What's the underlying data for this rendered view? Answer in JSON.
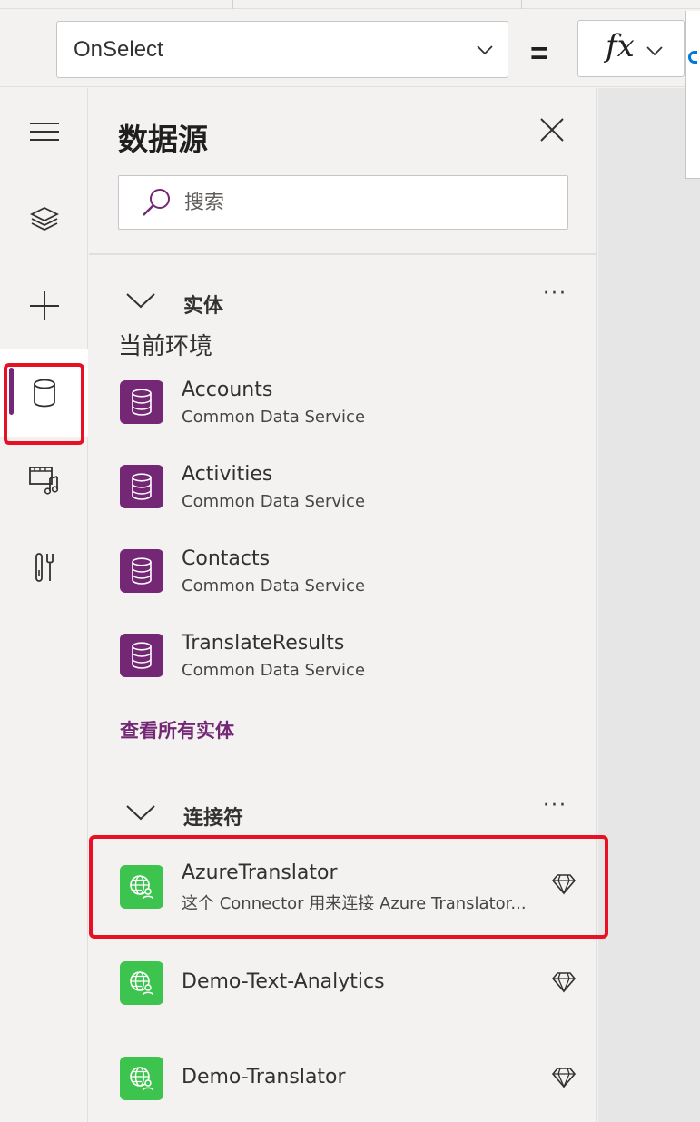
{
  "formula_bar": {
    "property": "OnSelect",
    "equals": "=",
    "fx_label": "fx"
  },
  "rail": {
    "items": [
      {
        "name": "hamburger-menu-icon"
      },
      {
        "name": "layers-icon"
      },
      {
        "name": "insert-plus-icon"
      },
      {
        "name": "database-icon",
        "active": true
      },
      {
        "name": "media-icon"
      },
      {
        "name": "tools-icon"
      }
    ]
  },
  "panel": {
    "title": "数据源",
    "search_placeholder": "搜索",
    "entities": {
      "heading": "实体",
      "more": "···",
      "environment": "当前环境",
      "items": [
        {
          "name": "Accounts",
          "source": "Common Data Service"
        },
        {
          "name": "Activities",
          "source": "Common Data Service"
        },
        {
          "name": "Contacts",
          "source": "Common Data Service"
        },
        {
          "name": "TranslateResults",
          "source": "Common Data Service"
        }
      ],
      "see_all": "查看所有实体"
    },
    "connectors": {
      "heading": "连接符",
      "more": "···",
      "items": [
        {
          "name": "AzureTranslator",
          "description": "这个 Connector 用来连接 Azure Translator..."
        },
        {
          "name": "Demo-Text-Analytics",
          "description": ""
        },
        {
          "name": "Demo-Translator",
          "description": ""
        }
      ]
    }
  },
  "colors": {
    "accent": "#742774",
    "connector_green": "#3dc44f",
    "highlight_red": "#e81123"
  }
}
